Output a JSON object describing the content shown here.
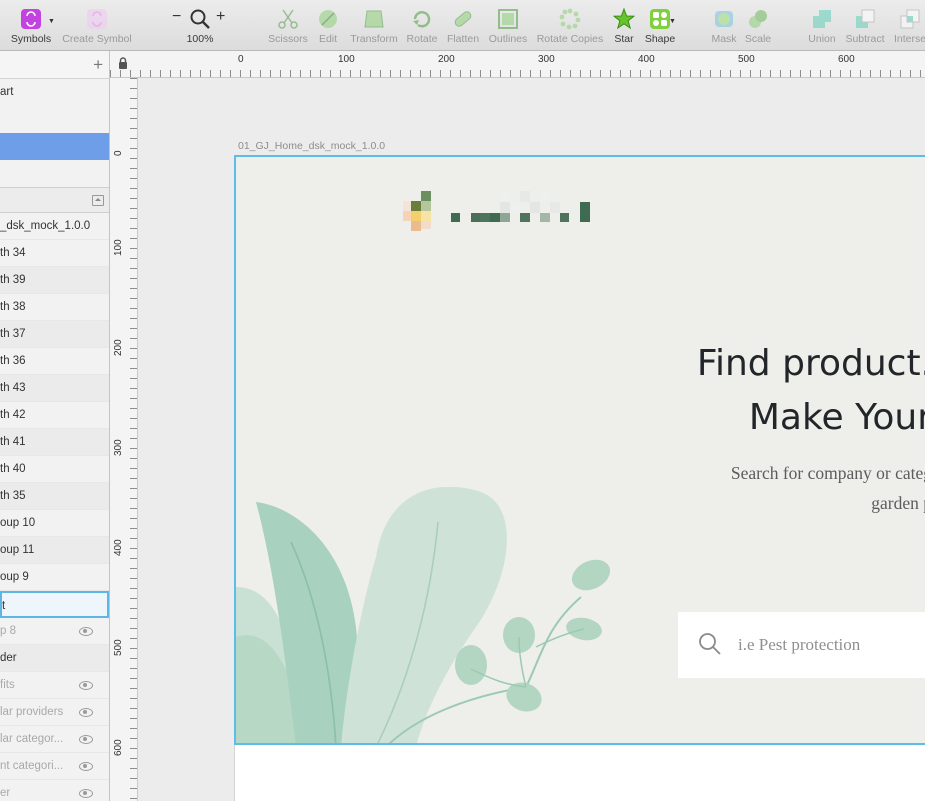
{
  "toolbar": {
    "symbols": "Symbols",
    "create_symbol": "Create Symbol",
    "zoom_minus": "−",
    "zoom_plus": "+",
    "zoom_level": "100%",
    "scissors": "Scissors",
    "edit": "Edit",
    "transform": "Transform",
    "rotate": "Rotate",
    "flatten": "Flatten",
    "outlines": "Outlines",
    "rotate_copies": "Rotate Copies",
    "star": "Star",
    "shape": "Shape",
    "mask": "Mask",
    "scale": "Scale",
    "union": "Union",
    "subtract": "Subtract",
    "intersect": "Interse"
  },
  "pages": {
    "items": [
      "art",
      "",
      "",
      ""
    ]
  },
  "layers": {
    "artboard": "_dsk_mock_1.0.0",
    "items": [
      "th 34",
      "th 39",
      "th 38",
      "th 37",
      "th 36",
      "th 43",
      "th 42",
      "th 41",
      "th 40",
      "th 35",
      "oup 10",
      "oup 11",
      "oup 9",
      "t",
      "p 8",
      "der",
      "fits",
      "lar providers",
      "lar categor...",
      "nt categori...",
      "er"
    ]
  },
  "ruler": {
    "top": [
      "0",
      "100",
      "200",
      "300",
      "400",
      "500",
      "600"
    ],
    "left": [
      "0",
      "100",
      "200",
      "300",
      "400",
      "500",
      "600"
    ]
  },
  "artboard": {
    "name": "01_GJ_Home_dsk_mock_1.0.0",
    "title_line1": "Find product.",
    "title_line2": "Make Your",
    "subtitle_line1": "Search for company or categ",
    "subtitle_line2": "garden p",
    "search_placeholder": "i.e Pest protection"
  },
  "colors": {
    "selection_blue": "#6f9ee8",
    "artboard_border": "#5cbde8",
    "leaf_green": "#a9d1bf",
    "star_green": "#66c52c"
  }
}
